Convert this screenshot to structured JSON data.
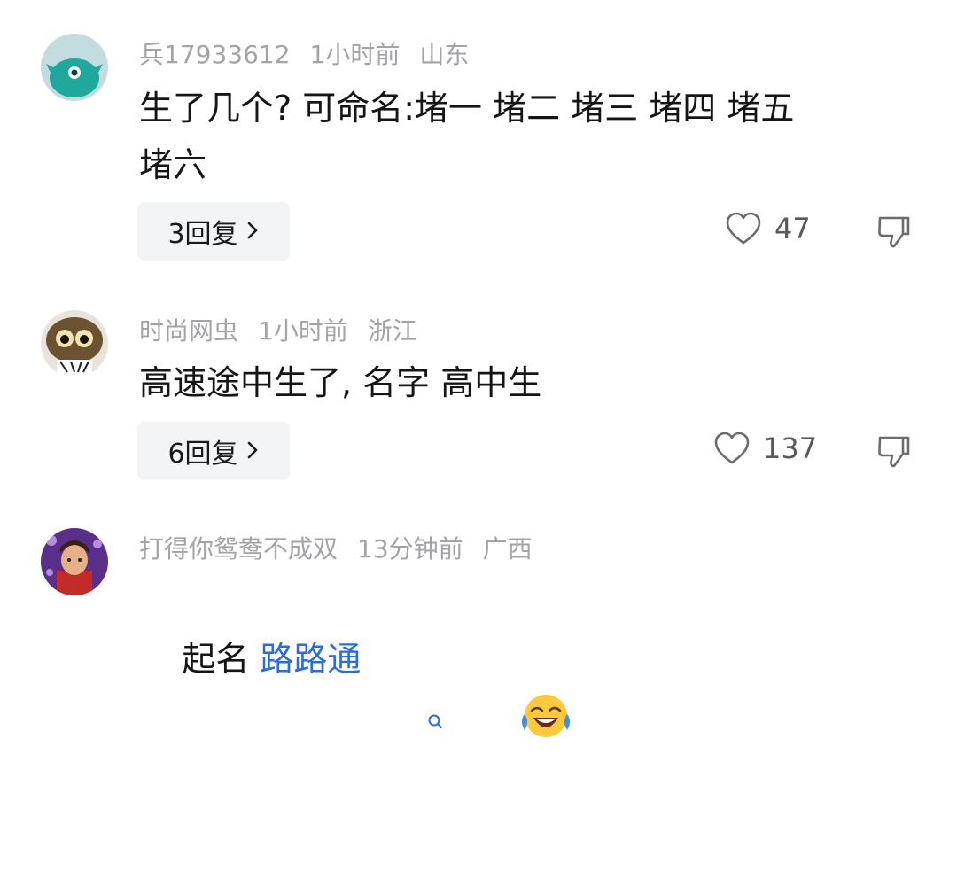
{
  "comments": [
    {
      "username": "兵17933612",
      "time": "1小时前",
      "location": "山东",
      "text": "生了几个? 可命名:堵一 堵二 堵三 堵四 堵五\n堵六",
      "reply_label": "3回复",
      "likes": "47",
      "avatar_icon": "teal-monster-avatar"
    },
    {
      "username": "时尚网虫",
      "time": "1小时前",
      "location": "浙江",
      "text": "高速途中生了, 名字 高中生",
      "reply_label": "6回复",
      "likes": "137",
      "avatar_icon": "bug-eyed-creature-avatar"
    },
    {
      "username": "打得你鸳鸯不成双",
      "time": "13分钟前",
      "location": "广西",
      "text_prefix": "起名 ",
      "link_text": "路路通",
      "avatar_icon": "character-portrait-avatar"
    }
  ],
  "icons": {
    "like": "heart-outline-icon",
    "dislike": "thumbs-down-outline-icon",
    "search": "search-small-icon",
    "emoji": "laughing-crying-emoji"
  },
  "colors": {
    "meta": "#a3a3a8",
    "link": "#2c6bd9",
    "reply_bg": "#f3f4f6"
  }
}
